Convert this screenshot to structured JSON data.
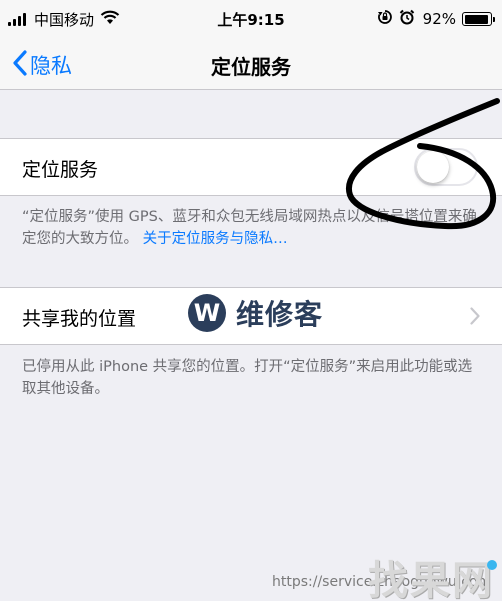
{
  "status_bar": {
    "carrier": "中国移动",
    "time": "上午9:15",
    "battery_percent": "92%",
    "icons": [
      "signal-bars-icon",
      "wifi-icon",
      "rotation-lock-icon",
      "alarm-icon",
      "battery-icon"
    ]
  },
  "nav": {
    "back_label": "隐私",
    "title": "定位服务"
  },
  "location_services": {
    "label": "定位服务",
    "toggle_on": false
  },
  "location_footer": {
    "text": "“定位服务”使用 GPS、蓝牙和众包无线局域网热点以及信号塔位置来确定您的大致方位。",
    "link": "关于定位服务与隐私…"
  },
  "share_location": {
    "label": "共享我的位置"
  },
  "share_footer": {
    "text": "已停用从此 iPhone 共享您的位置。打开“定位服务”来启用此功能或选取其他设备。"
  },
  "watermarks": {
    "logo_letter": "W",
    "logo_text": "维修客",
    "url": "https://service.zhaoguowu.com",
    "brand": "找果网"
  },
  "colors": {
    "accent": "#0a7aff",
    "background": "#efeff4",
    "footer_text": "#6d6d72"
  }
}
